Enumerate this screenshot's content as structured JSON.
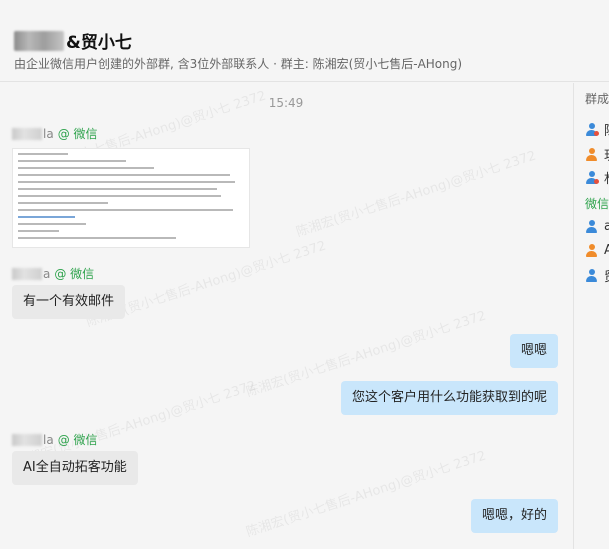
{
  "header": {
    "title_suffix": "&贸小七",
    "subtitle": "由企业微信用户创建的外部群, 含3位外部联系人 · 群主: 陈湘宏(贸小七售后-AHong)"
  },
  "chat": {
    "timestamp": "15:49",
    "wechat_tag": "@ 微信",
    "messages": [
      {
        "sender_suffix": "la",
        "type": "image"
      },
      {
        "sender_suffix": "a",
        "type": "text",
        "text": "有一个有效邮件"
      },
      {
        "side": "right",
        "type": "text",
        "text": "嗯嗯"
      },
      {
        "side": "right",
        "type": "text",
        "text": "您这个客户用什么功能获取到的呢"
      },
      {
        "sender_suffix": "la",
        "type": "text",
        "text": "AI全自动拓客功能"
      },
      {
        "side": "right",
        "type": "text",
        "text": "嗯嗯，好的"
      }
    ]
  },
  "sidebar": {
    "title": "群成",
    "members_internal": [
      {
        "name": "陈",
        "icon": "person-blue-icon"
      },
      {
        "name": "玥",
        "icon": "person-orange-icon"
      },
      {
        "name": "林",
        "icon": "person-blue-icon"
      }
    ],
    "section_wechat": "微信",
    "members_wechat": [
      {
        "name": "a",
        "icon": "person-blue-icon"
      },
      {
        "name": "A",
        "icon": "person-orange-icon"
      },
      {
        "name": "贸",
        "icon": "person-blue-icon"
      }
    ]
  },
  "watermark_text": "陈湘宏(贸小七售后-AHong)@贸小七 2372",
  "colors": {
    "incoming_bubble": "#e9e9e9",
    "outgoing_bubble": "#c9e6fb",
    "wechat_green": "#2fa34d"
  }
}
